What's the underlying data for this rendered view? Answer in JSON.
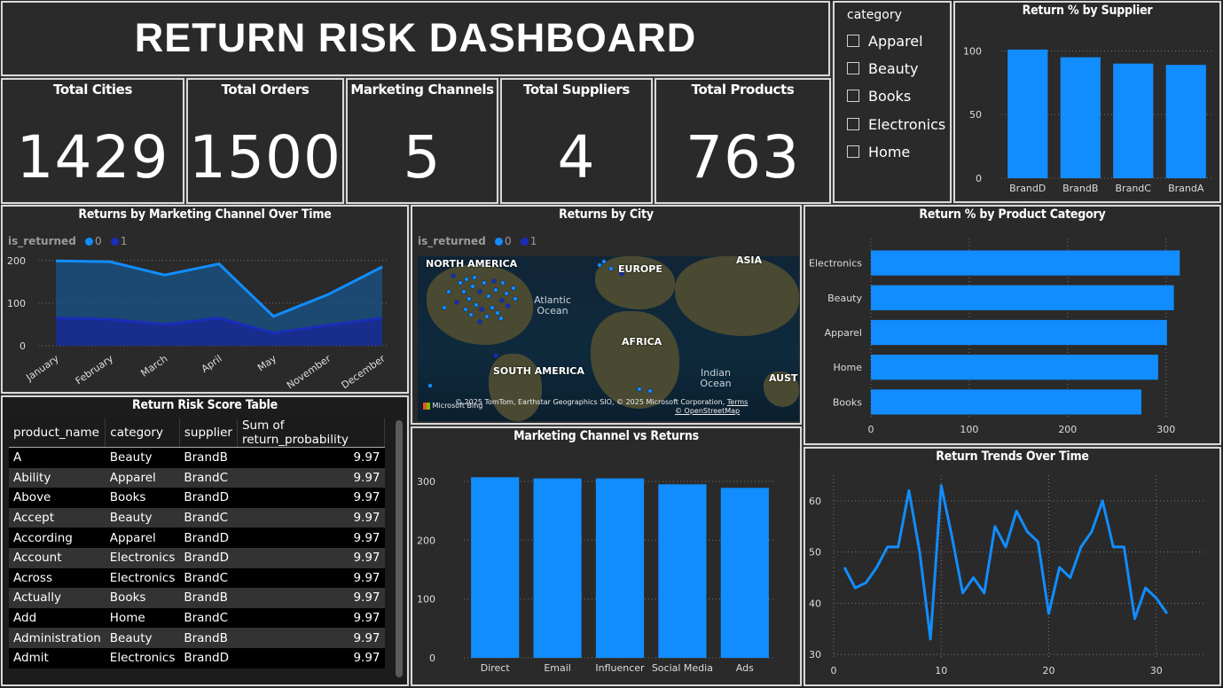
{
  "title": "RETURN RISK DASHBOARD",
  "kpis": [
    {
      "label": "Total Cities",
      "value": "1429"
    },
    {
      "label": "Total Orders",
      "value": "1500"
    },
    {
      "label": "Marketing Channels",
      "value": "5"
    },
    {
      "label": "Total Suppliers",
      "value": "4"
    },
    {
      "label": "Total Products",
      "value": "763"
    }
  ],
  "slicer": {
    "title": "category",
    "items": [
      "Apparel",
      "Beauty",
      "Books",
      "Electronics",
      "Home"
    ]
  },
  "supplier_chart": {
    "title": "Return % by Supplier",
    "chart_data": {
      "type": "bar",
      "categories": [
        "BrandD",
        "BrandB",
        "BrandC",
        "BrandA"
      ],
      "values": [
        101,
        95,
        90,
        89
      ],
      "ylim": [
        0,
        110
      ],
      "yticks": [
        0,
        50,
        100
      ],
      "color": "#118DFF"
    }
  },
  "channel_time_chart": {
    "title": "Returns by Marketing Channel Over Time",
    "legend_title": "is_returned",
    "legend": [
      "0",
      "1"
    ],
    "chart_data": {
      "type": "area",
      "categories": [
        "January",
        "February",
        "March",
        "April",
        "May",
        "November",
        "December"
      ],
      "series": [
        {
          "name": "0",
          "values": [
            199,
            197,
            166,
            192,
            69,
            120,
            185
          ],
          "color": "#118DFF"
        },
        {
          "name": "1",
          "values": [
            65,
            62,
            50,
            65,
            30,
            48,
            65
          ],
          "color": "#1a2db8"
        }
      ],
      "ylim": [
        0,
        210
      ],
      "yticks": [
        0,
        100,
        200
      ]
    }
  },
  "city_map": {
    "title": "Returns by City",
    "legend_title": "is_returned",
    "legend": [
      "0",
      "1"
    ],
    "labels": [
      "NORTH AMERICA",
      "EUROPE",
      "ASIA",
      "AFRICA",
      "SOUTH AMERICA",
      "AUST"
    ],
    "oceans": [
      "Atlantic Ocean",
      "Indian Ocean"
    ],
    "credit": "© 2025 TomTom, Earthstar Geographics SIO, © 2025 Microsoft Corporation,",
    "terms": "Terms",
    "osm": "© OpenStreetMap",
    "bing": "Microsoft Bing"
  },
  "category_chart": {
    "title": "Return % by Product Category",
    "chart_data": {
      "type": "bar",
      "orientation": "horizontal",
      "categories": [
        "Electronics",
        "Beauty",
        "Apparel",
        "Home",
        "Books"
      ],
      "values": [
        314,
        308,
        301,
        292,
        275
      ],
      "xlim": [
        0,
        330
      ],
      "xticks": [
        0,
        100,
        200,
        300
      ],
      "color": "#118DFF"
    }
  },
  "risk_table": {
    "title": "Return Risk Score Table",
    "columns": [
      "product_name",
      "category",
      "supplier",
      "Sum of return_probability"
    ],
    "rows": [
      [
        "A",
        "Beauty",
        "BrandB",
        "9.97"
      ],
      [
        "Ability",
        "Apparel",
        "BrandC",
        "9.97"
      ],
      [
        "Above",
        "Books",
        "BrandD",
        "9.97"
      ],
      [
        "Accept",
        "Beauty",
        "BrandC",
        "9.97"
      ],
      [
        "According",
        "Apparel",
        "BrandD",
        "9.97"
      ],
      [
        "Account",
        "Electronics",
        "BrandD",
        "9.97"
      ],
      [
        "Across",
        "Electronics",
        "BrandC",
        "9.97"
      ],
      [
        "Actually",
        "Books",
        "BrandB",
        "9.97"
      ],
      [
        "Add",
        "Home",
        "BrandC",
        "9.97"
      ],
      [
        "Administration",
        "Beauty",
        "BrandB",
        "9.97"
      ],
      [
        "Admit",
        "Electronics",
        "BrandD",
        "9.97"
      ]
    ]
  },
  "channel_chart": {
    "title": "Marketing Channel vs Returns",
    "chart_data": {
      "type": "bar",
      "categories": [
        "Direct",
        "Email",
        "Influencer",
        "Social Media",
        "Ads"
      ],
      "values": [
        307,
        305,
        305,
        295,
        289
      ],
      "ylim": [
        0,
        315
      ],
      "yticks": [
        0,
        100,
        200,
        300
      ],
      "color": "#118DFF"
    }
  },
  "trend_chart": {
    "title": "Return Trends Over Time",
    "chart_data": {
      "type": "line",
      "x": [
        1,
        2,
        3,
        4,
        5,
        6,
        7,
        8,
        9,
        10,
        11,
        12,
        13,
        14,
        15,
        16,
        17,
        18,
        19,
        20,
        21,
        22,
        23,
        24,
        25,
        26,
        27,
        28,
        29,
        30,
        31
      ],
      "y": [
        47,
        43,
        44,
        47,
        51,
        51,
        62,
        50,
        33,
        63,
        53,
        42,
        45,
        42,
        55,
        51,
        58,
        54,
        52,
        38,
        47,
        45,
        51,
        54,
        60,
        51,
        51,
        37,
        43,
        41,
        38
      ],
      "xlim": [
        0,
        32
      ],
      "ylim": [
        29,
        65
      ],
      "xticks": [
        0,
        10,
        20,
        30
      ],
      "yticks": [
        30,
        40,
        50,
        60
      ],
      "color": "#118DFF"
    }
  }
}
